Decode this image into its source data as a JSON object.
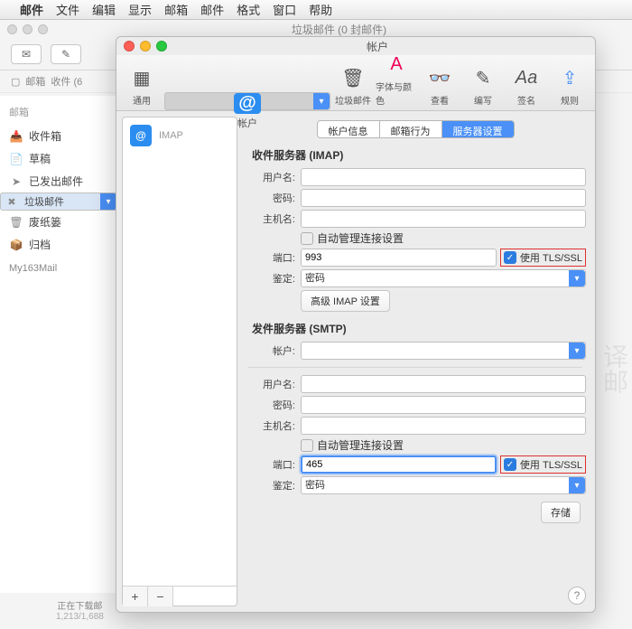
{
  "menubar": {
    "app": "邮件",
    "items": [
      "文件",
      "编辑",
      "显示",
      "邮箱",
      "邮件",
      "格式",
      "窗口",
      "帮助"
    ]
  },
  "mainwin": {
    "title": "垃圾邮件 (0 封邮件)"
  },
  "crumb": {
    "inbox": "邮箱",
    "recv": "收件 (6"
  },
  "sidebar": {
    "header": "邮箱",
    "items": [
      {
        "label": "收件箱"
      },
      {
        "label": "草稿"
      },
      {
        "label": "已发出邮件"
      },
      {
        "label": "垃圾邮件"
      },
      {
        "label": "废纸篓"
      },
      {
        "label": "归档"
      }
    ],
    "account": "My163Mail"
  },
  "status": {
    "line1": "正在下载邮",
    "line2": "1,213/1,688"
  },
  "pref": {
    "title": "帐户",
    "tabs": [
      "通用",
      "帐户",
      "垃圾邮件",
      "字体与颜色",
      "查看",
      "编写",
      "签名",
      "规则"
    ],
    "acctType": "IMAP"
  },
  "segtabs": {
    "t1": "帐户信息",
    "t2": "邮箱行为",
    "t3": "服务器设置"
  },
  "incoming": {
    "title": "收件服务器 (IMAP)",
    "user": "用户名:",
    "pass": "密码:",
    "host": "主机名:",
    "auto": "自动管理连接设置",
    "port_l": "端口:",
    "port_v": "993",
    "tls": "使用 TLS/SSL",
    "auth_l": "鉴定:",
    "auth_v": "密码",
    "adv": "高级 IMAP 设置"
  },
  "outgoing": {
    "title": "发件服务器 (SMTP)",
    "acct": "帐户:",
    "user": "用户名:",
    "pass": "密码:",
    "host": "主机名:",
    "auto": "自动管理连接设置",
    "port_l": "端口:",
    "port_v": "465",
    "tls": "使用 TLS/SSL",
    "auth_l": "鉴定:",
    "auth_v": "密码"
  },
  "save": "存储",
  "partial": "译邮"
}
